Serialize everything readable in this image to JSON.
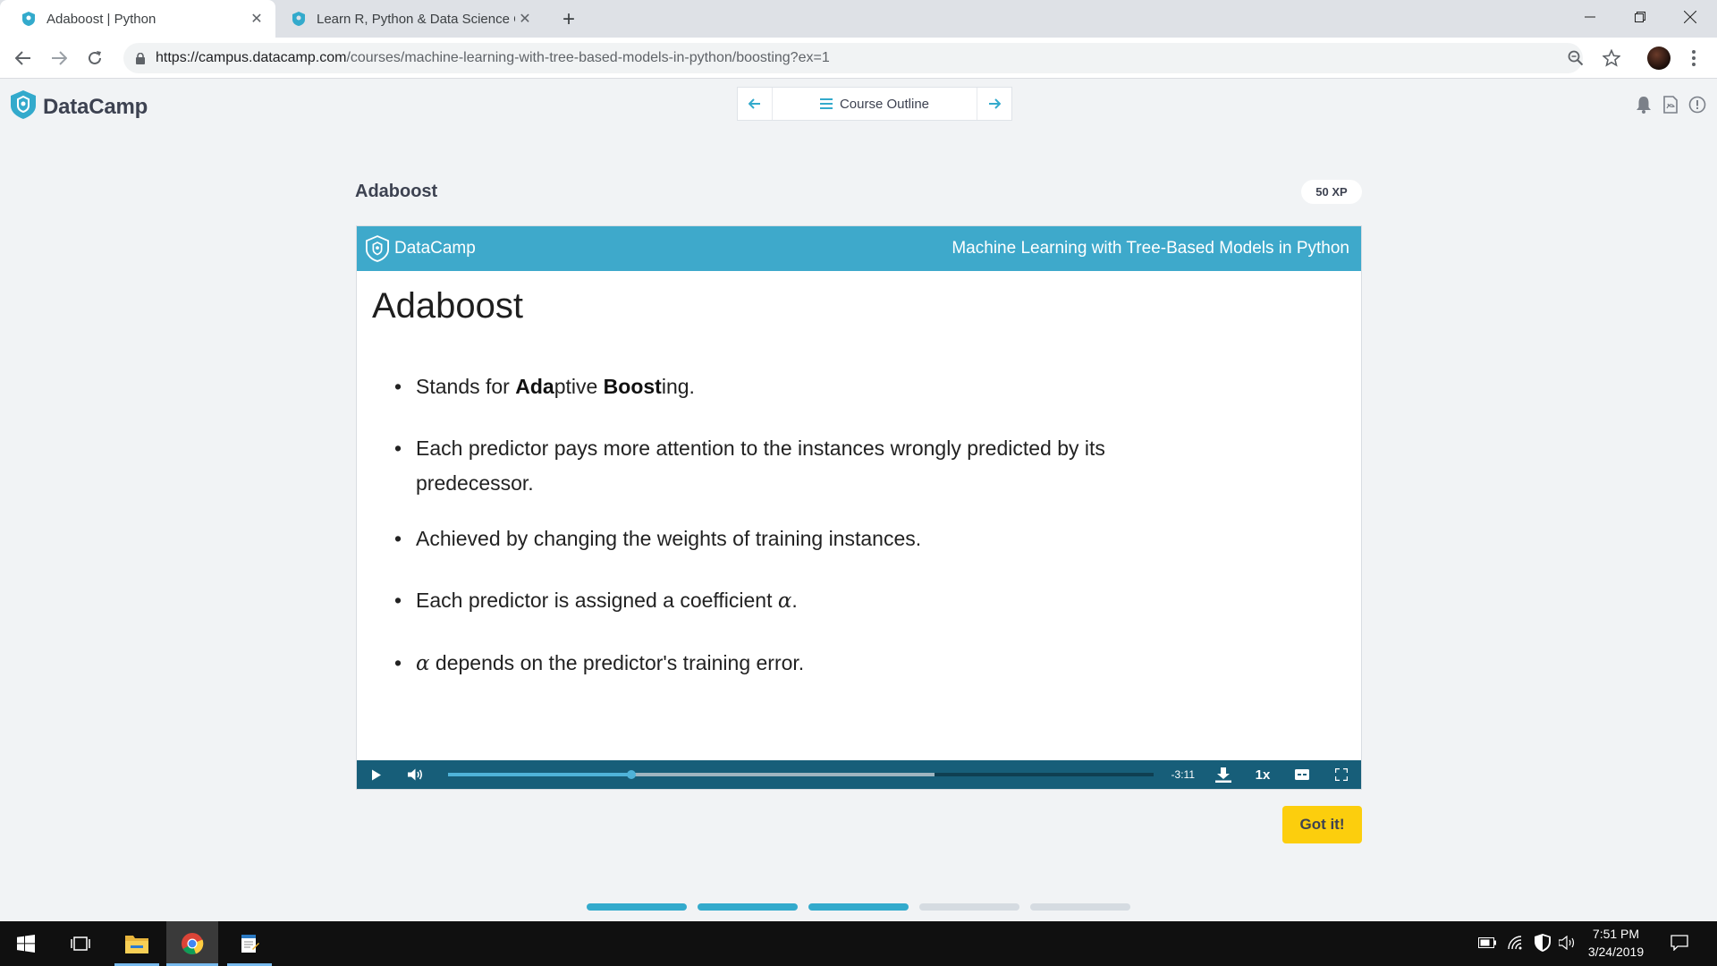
{
  "browser": {
    "tabs": [
      {
        "title": "Adaboost | Python",
        "active": true
      },
      {
        "title": "Learn R, Python & Data Science C",
        "active": false
      }
    ],
    "url_host": "https://campus.datacamp.com",
    "url_path": "/courses/machine-learning-with-tree-based-models-in-python/boosting?ex=1"
  },
  "header": {
    "logo_text": "DataCamp",
    "course_outline_label": "Course Outline"
  },
  "exercise": {
    "title": "Adaboost",
    "xp": "50 XP",
    "got_it_label": "Got it!"
  },
  "slide": {
    "brand": "DataCamp",
    "course": "Machine Learning with Tree-Based Models in Python",
    "title": "Adaboost",
    "bullets": {
      "b1_pre": "Stands for ",
      "b1_bold1": "Ada",
      "b1_mid": "ptive ",
      "b1_bold2": "Boost",
      "b1_post": "ing.",
      "b2": "Each predictor pays more attention to the instances wrongly predicted by its predecessor.",
      "b3": "Achieved by changing the weights of training instances.",
      "b4_pre": "Each predictor is assigned a coefficient ",
      "b4_symbol": "α",
      "b4_post": ".",
      "b5_symbol": "α",
      "b5_post": " depends on the predictor's training error."
    }
  },
  "player": {
    "time_remaining": "-3:11",
    "speed": "1x",
    "played_fraction": 0.26,
    "buffered_fraction": 0.69
  },
  "pager": {
    "segments": [
      "done",
      "done",
      "done",
      "todo",
      "todo"
    ],
    "colors": {
      "done": "#33aacc",
      "todo": "#d5dbe1"
    }
  },
  "taskbar": {
    "time": "7:51 PM",
    "date": "3/24/2019"
  },
  "colors": {
    "brand_blue": "#3ea9cb",
    "player_bar": "#175e79",
    "got_it": "#fcce0d"
  }
}
